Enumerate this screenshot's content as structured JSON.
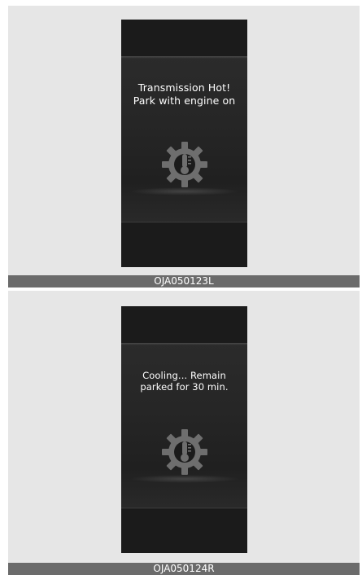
{
  "panels": [
    {
      "message_lines": [
        "Transmission Hot!",
        "Park with engine on"
      ],
      "icon": "transmission-temperature-gear-icon",
      "caption": "OJA050123L"
    },
    {
      "message_lines": [
        "Cooling... Remain",
        "parked for 30 min."
      ],
      "icon": "transmission-temperature-gear-icon",
      "caption": "OJA050124R"
    }
  ],
  "colors": {
    "screen_bg": "#1b1b1b",
    "panel_bg": "#e6e6e6",
    "caption_bg": "#6b6b6b",
    "text": "#ffffff",
    "icon": "#6e6e6e"
  }
}
